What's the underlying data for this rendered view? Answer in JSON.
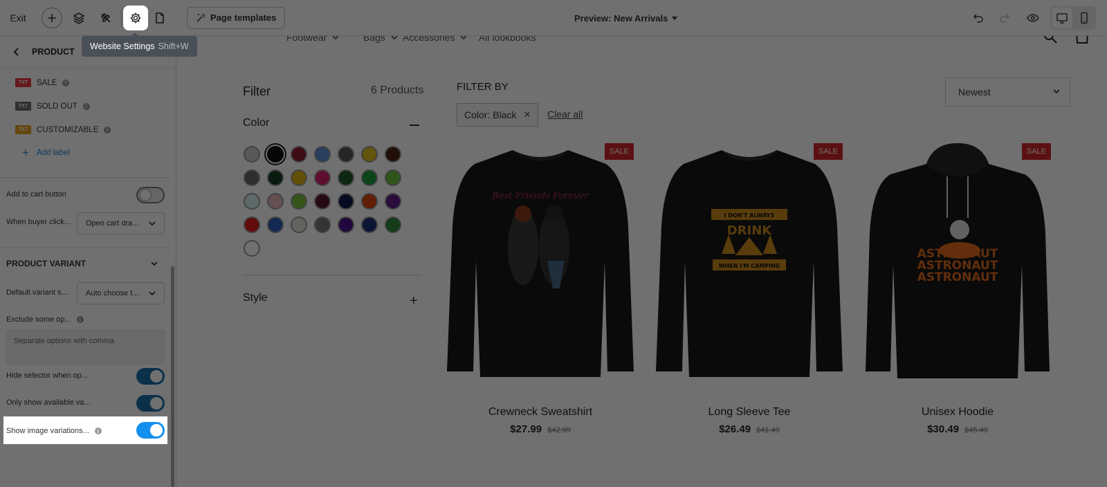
{
  "toolbar": {
    "exit_label": "Exit",
    "templates_label": "Page templates",
    "preview_label": "Preview: New Arrivals"
  },
  "tooltip": {
    "title": "Website Settings",
    "shortcut": "Shift+W"
  },
  "panel": {
    "heading": "PRODUCT",
    "labels": [
      {
        "text": "SALE",
        "badge": "TXT",
        "color": "#e8383e"
      },
      {
        "text": "SOLD OUT",
        "badge": "TXT",
        "color": "#707070"
      },
      {
        "text": "CUSTOMIZABLE",
        "badge": "TXT",
        "color": "#e6a21e"
      }
    ],
    "add_label": "Add label",
    "add_to_cart_label": "Add to cart button",
    "add_to_cart_on": false,
    "when_buyer_clicks_label": "When buyer click...",
    "when_buyer_clicks_value": "Open cart dra...",
    "variant_section_title": "PRODUCT VARIANT",
    "default_variant_label": "Default variant s...",
    "default_variant_value": "Auto choose t...",
    "exclude_label": "Exclude some op...",
    "exclude_placeholder": "Separate options with comma",
    "hide_selector_label": "Hide selector when op...",
    "hide_selector_on": true,
    "only_available_label": "Only show available va...",
    "only_available_on": true,
    "show_image_variations_label": "Show image variations...",
    "show_image_variations_on": true
  },
  "store": {
    "nav": [
      "Footwear",
      "Bags",
      "Accessories",
      "All lookbooks"
    ],
    "filter_title": "Filter",
    "product_count": "6 Products",
    "color_title": "Color",
    "swatch_colors": [
      "#c8c8c8",
      "#111111",
      "#8b1a2e",
      "#5b8fd4",
      "#555555",
      "#e2c21a",
      "#4a2514",
      "#6a6a6a",
      "#133f22",
      "#e2b512",
      "#d6246e",
      "#1d5c2a",
      "#1b9c3a",
      "#6bc23f",
      "#d6eef2",
      "#e3b7b7",
      "#7cc23e",
      "#5c1a2a",
      "#111a4e",
      "#e0450e",
      "#5e1f8a",
      "#e01b1b",
      "#2f5cc0",
      "#e6e1d4",
      "#777777",
      "#4a108c",
      "#1b3278",
      "#2f8a3d",
      "#ffffff"
    ],
    "selected_swatch": 1,
    "style_title": "Style",
    "filter_by_label": "FILTER BY",
    "active_chip": "Color: Black",
    "clear_all": "Clear all",
    "sort_value": "Newest",
    "products": [
      {
        "name": "Crewneck Sweatshirt",
        "price": "$27.99",
        "compare": "$42.99",
        "badge": "SALE",
        "art": "Best Friends Forever"
      },
      {
        "name": "Long Sleeve Tee",
        "price": "$26.49",
        "compare": "$41.49",
        "badge": "SALE",
        "art": "I DON'T ALWAYS DRINK WHEN I'M CAMPING"
      },
      {
        "name": "Unisex Hoodie",
        "price": "$30.49",
        "compare": "$45.49",
        "badge": "SALE",
        "art": "ASTRONAUT"
      }
    ]
  },
  "icons": {
    "toolbar": [
      "plus-icon",
      "layers-icon",
      "tools-icon",
      "gear-icon",
      "page-icon",
      "wand-icon"
    ],
    "right": [
      "undo-icon",
      "redo-icon",
      "eye-icon",
      "desktop-icon",
      "mobile-icon"
    ]
  }
}
